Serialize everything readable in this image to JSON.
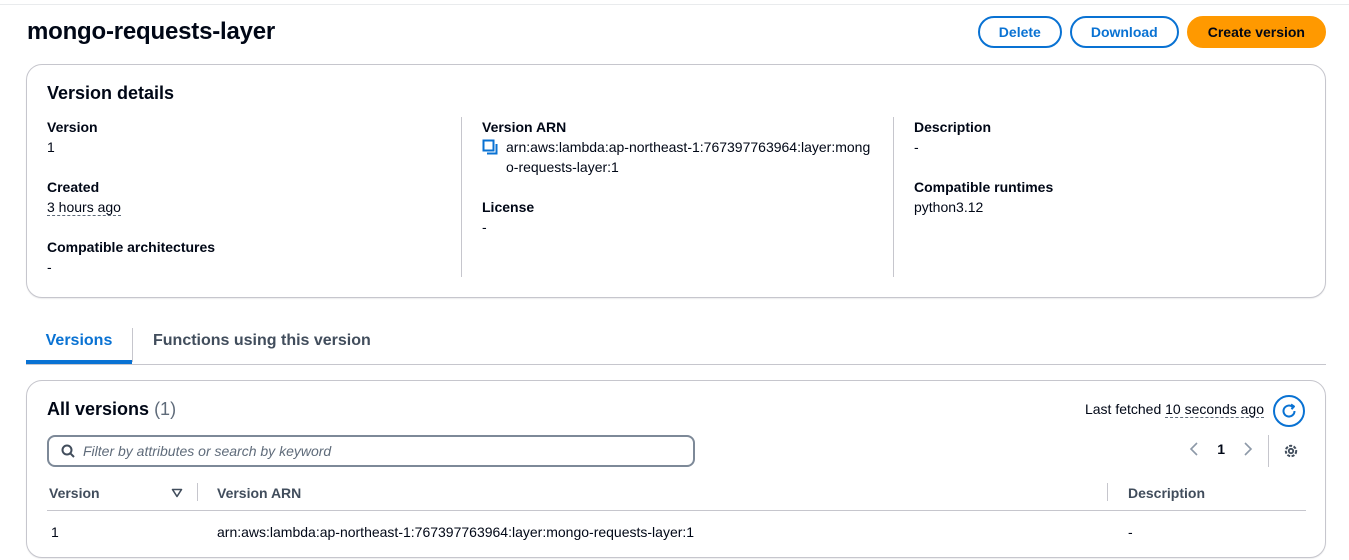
{
  "header": {
    "title": "mongo-requests-layer",
    "buttons": {
      "delete": "Delete",
      "download": "Download",
      "create_version": "Create version"
    }
  },
  "details": {
    "title": "Version details",
    "version": {
      "label": "Version",
      "value": "1"
    },
    "created": {
      "label": "Created",
      "value": "3 hours ago"
    },
    "compatible_architectures": {
      "label": "Compatible architectures",
      "value": "-"
    },
    "version_arn": {
      "label": "Version ARN",
      "value": "arn:aws:lambda:ap-northeast-1:767397763964:layer:mongo-requests-layer:1"
    },
    "license": {
      "label": "License",
      "value": "-"
    },
    "description": {
      "label": "Description",
      "value": "-"
    },
    "compatible_runtimes": {
      "label": "Compatible runtimes",
      "value": "python3.12"
    }
  },
  "tabs": [
    {
      "label": "Versions",
      "active": true
    },
    {
      "label": "Functions using this version",
      "active": false
    }
  ],
  "versions": {
    "title": "All versions",
    "count": "(1)",
    "last_fetched_label": "Last fetched",
    "last_fetched_value": "10 seconds ago",
    "search_placeholder": "Filter by attributes or search by keyword",
    "current_page": "1",
    "columns": [
      "Version",
      "Version ARN",
      "Description"
    ],
    "rows": [
      {
        "version": "1",
        "arn": "arn:aws:lambda:ap-northeast-1:767397763964:layer:mongo-requests-layer:1",
        "description": "-"
      }
    ]
  },
  "colors": {
    "accent": "#0972d3",
    "primary_button": "#ff9900",
    "text": "#000716",
    "border": "#c6c6cd"
  }
}
